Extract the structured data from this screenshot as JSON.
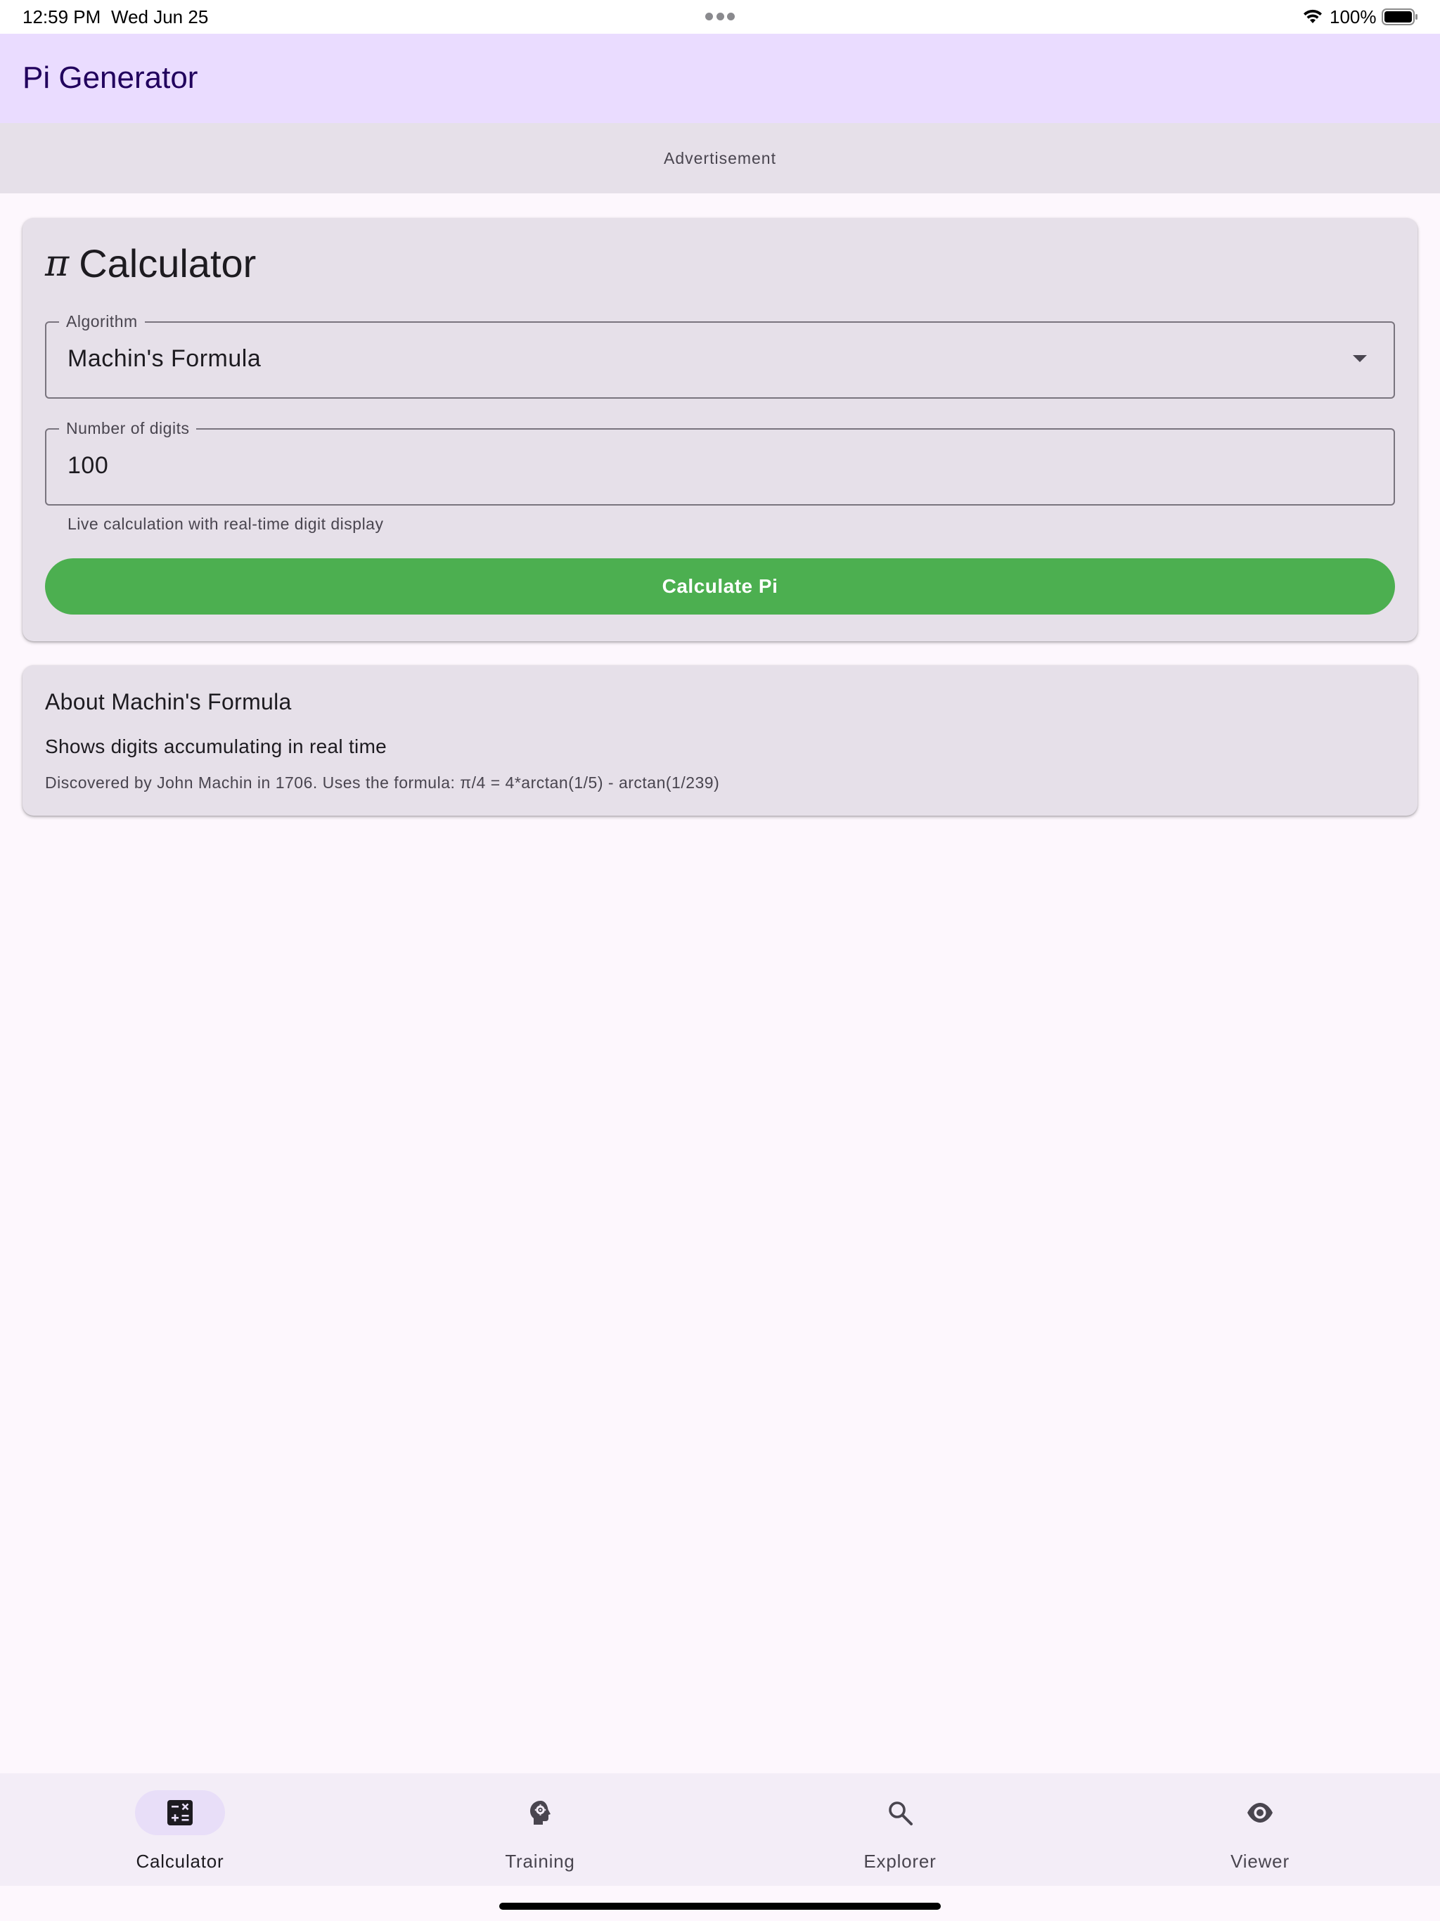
{
  "status_bar": {
    "time": "12:59 PM",
    "date": "Wed Jun 25",
    "battery": "100%",
    "icons": [
      "more-dots-icon",
      "wifi-icon",
      "battery-icon"
    ]
  },
  "app_bar": {
    "title": "Pi Generator"
  },
  "ad": {
    "label": "Advertisement"
  },
  "calculator": {
    "symbol": "π",
    "title": "Calculator",
    "algorithm": {
      "label": "Algorithm",
      "value": "Machin's Formula"
    },
    "digits": {
      "label": "Number of digits",
      "value": "100"
    },
    "helper": "Live calculation with real-time digit display",
    "button": "Calculate Pi"
  },
  "about": {
    "title": "About Machin's Formula",
    "subtitle": "Shows digits accumulating in real time",
    "description": "Discovered by John Machin in 1706. Uses the formula: π/4 = 4*arctan(1/5) - arctan(1/239)"
  },
  "bottom_nav": {
    "items": [
      {
        "label": "Calculator",
        "icon": "calculator-icon",
        "active": true
      },
      {
        "label": "Training",
        "icon": "psychology-icon",
        "active": false
      },
      {
        "label": "Explorer",
        "icon": "search-icon",
        "active": false
      },
      {
        "label": "Viewer",
        "icon": "eye-icon",
        "active": false
      }
    ]
  },
  "colors": {
    "app_bar": "#eadcff",
    "card": "#e6e0e9",
    "accent_button": "#4caf50",
    "nav_active_indicator": "#e8def8",
    "background": "#fdf7fd"
  }
}
